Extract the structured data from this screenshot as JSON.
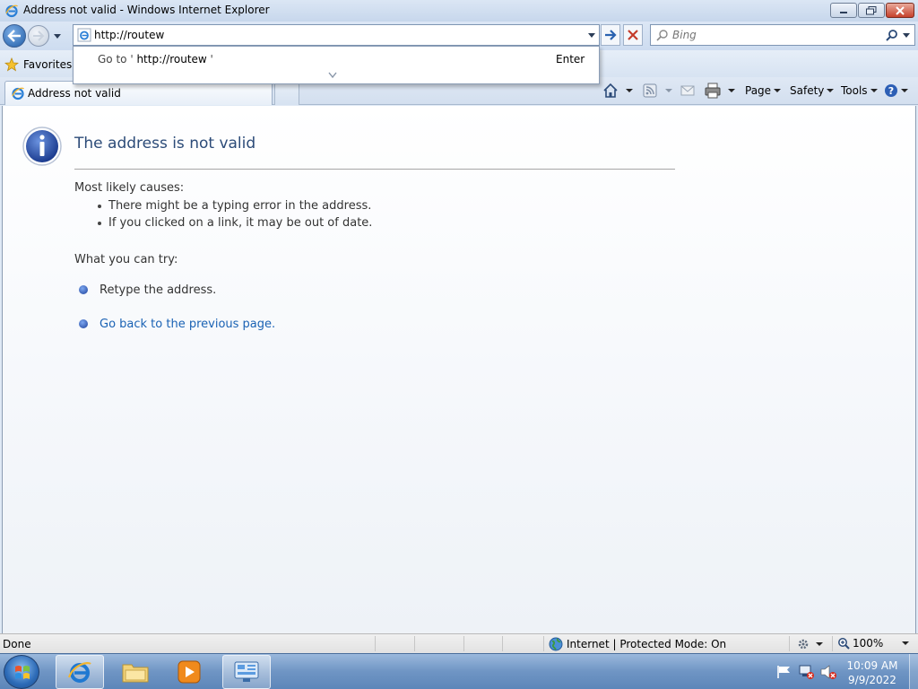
{
  "window": {
    "title": "Address not valid - Windows Internet Explorer"
  },
  "navigation": {
    "address_value": "http://routew",
    "search_placeholder": "Bing"
  },
  "autocomplete": {
    "goto_prefix": "Go to '",
    "goto_url": "http://routew",
    "goto_suffix": " '",
    "enter_label": "Enter"
  },
  "favorites_bar": {
    "favorites_label": "Favorites"
  },
  "tabs": [
    {
      "label": "Address not valid"
    }
  ],
  "command_bar": {
    "page_label": "Page",
    "safety_label": "Safety",
    "tools_label": "Tools"
  },
  "error_page": {
    "title": "The address is not valid",
    "causes_heading": "Most likely causes:",
    "causes": [
      "There might be a typing error in the address.",
      "If you clicked on a link, it may be out of date."
    ],
    "try_heading": "What you can try:",
    "try_items": [
      "Retype the address.",
      "Go back to the previous page."
    ]
  },
  "status_bar": {
    "status_text": "Done",
    "zone_text": "Internet | Protected Mode: On",
    "zoom_text": "100%"
  },
  "taskbar": {
    "time": "10:09 AM",
    "date": "9/9/2022"
  },
  "colors": {
    "title_blue": "#2c4b78",
    "link_blue": "#1a62b4",
    "close_red": "#c6412c"
  },
  "icons": [
    "ie-icon",
    "back-arrow-icon",
    "forward-arrow-icon",
    "go-arrow-icon",
    "stop-x-icon",
    "magnifier-icon",
    "star-icon",
    "home-icon",
    "feeds-icon",
    "mail-icon",
    "print-icon",
    "help-icon",
    "info-icon",
    "globe-icon",
    "windows-start-icon",
    "folder-icon",
    "media-player-icon",
    "network-icon",
    "flag-icon",
    "volume-muted-icon"
  ]
}
